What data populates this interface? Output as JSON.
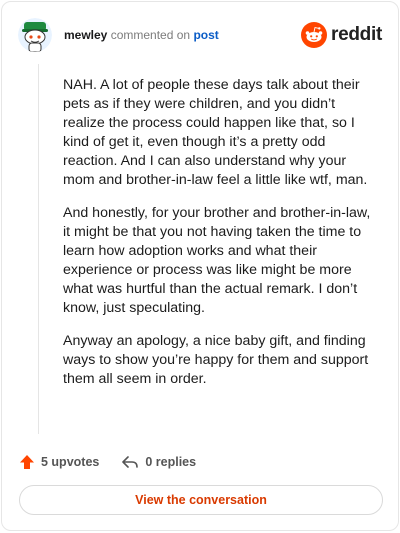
{
  "header": {
    "username": "mewley",
    "action_text": "commented on",
    "post_link": "post",
    "brand_name": "reddit",
    "brand_color": "#ff4500"
  },
  "comment": {
    "paragraphs": [
      "NAH. A lot of people these days talk about their pets as if they were children, and you didn’t realize the process could happen like that, so I kind of get it, even though it’s a pretty odd reaction. And I can also understand why your mom and brother-in-law feel a little like wtf, man.",
      "And honestly, for your brother and brother-in-law, it might be that you not having taken the time to learn how adoption works and what their experience or process was like might be more what was hurtful than the actual remark. I don’t know, just speculating.",
      "Anyway an apology, a nice baby gift, and finding ways to show you’re happy for them and support them all seem in order."
    ]
  },
  "footer": {
    "upvotes_label": "5 upvotes",
    "replies_label": "0 replies",
    "upvote_icon": "upvote-arrow-icon",
    "reply_icon": "reply-arrow-icon"
  },
  "cta": {
    "label": "View the conversation",
    "color": "#d93a00"
  }
}
